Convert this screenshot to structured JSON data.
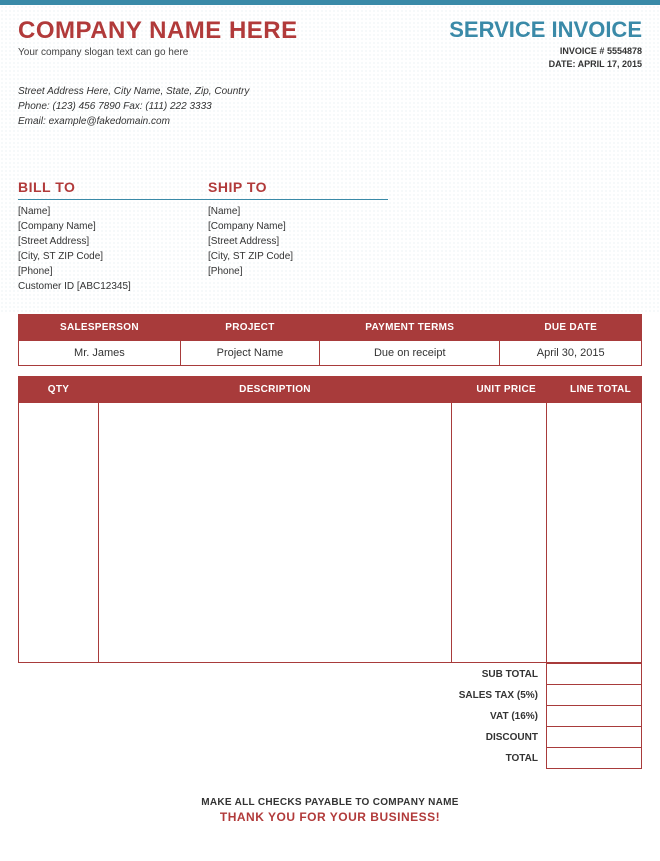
{
  "header": {
    "company_name": "COMPANY NAME HERE",
    "slogan": "Your company slogan text can go here",
    "address": "Street Address Here, City Name, State, Zip, Country",
    "phone_label": "Phone:",
    "phone": "(123) 456 7890",
    "fax_label": "Fax:",
    "fax": "(111) 222 3333",
    "email_label": "Email:",
    "email": "example@fakedomain.com",
    "invoice_title": "SERVICE INVOICE",
    "invoice_number_label": "INVOICE #",
    "invoice_number": "5554878",
    "date_label": "DATE:",
    "date": "APRIL 17, 2015"
  },
  "bill_to": {
    "heading": "BILL TO",
    "name": "[Name]",
    "company": "[Company Name]",
    "street": "[Street Address]",
    "city": "[City, ST  ZIP Code]",
    "phone": "[Phone]",
    "customer_id": "Customer ID [ABC12345]"
  },
  "ship_to": {
    "heading": "SHIP TO",
    "name": "[Name]",
    "company": "[Company Name]",
    "street": "[Street Address]",
    "city": "[City, ST  ZIP Code]",
    "phone": "[Phone]"
  },
  "meta": {
    "salesperson_label": "SALESPERSON",
    "project_label": "PROJECT",
    "terms_label": "PAYMENT TERMS",
    "due_label": "DUE DATE",
    "salesperson": "Mr. James",
    "project": "Project Name",
    "terms": "Due on receipt",
    "due": "April 30, 2015"
  },
  "items": {
    "qty_label": "QTY",
    "desc_label": "DESCRIPTION",
    "unit_label": "UNIT PRICE",
    "line_label": "LINE TOTAL"
  },
  "totals": {
    "subtotal_label": "SUB TOTAL",
    "sales_tax_label": "SALES TAX (5%)",
    "vat_label": "VAT (16%)",
    "discount_label": "DISCOUNT",
    "total_label": "TOTAL",
    "subtotal": "",
    "sales_tax": "",
    "vat": "",
    "discount": "",
    "total": ""
  },
  "footer": {
    "line1": "MAKE ALL CHECKS PAYABLE TO COMPANY NAME",
    "line2": "THANK YOU FOR YOUR BUSINESS!"
  }
}
